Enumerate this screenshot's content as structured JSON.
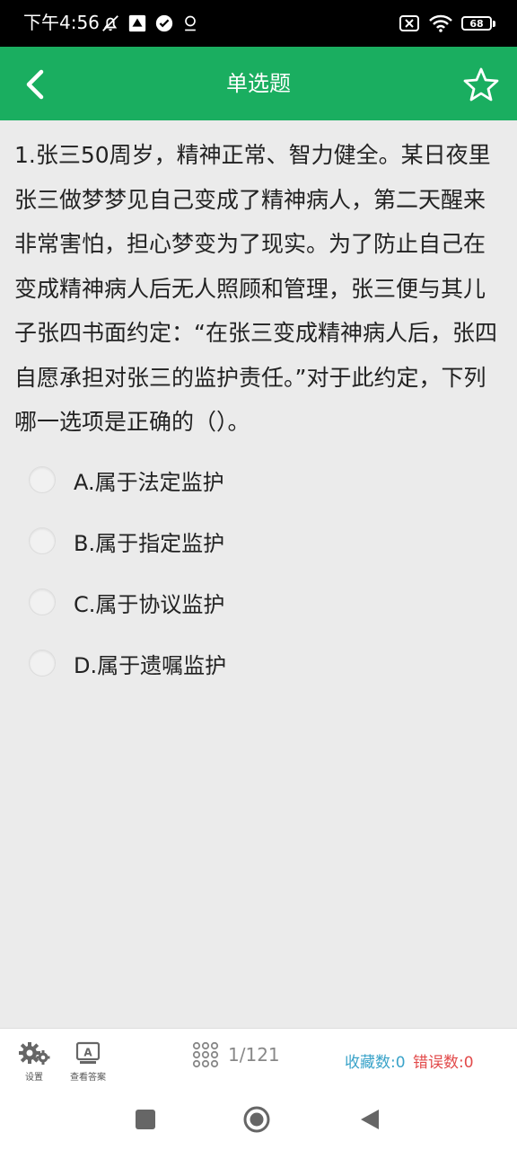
{
  "status": {
    "time": "下午4:56",
    "battery": "68"
  },
  "appbar": {
    "title": "单选题"
  },
  "question": {
    "text": "1.张三50周岁，精神正常、智力健全。某日夜里张三做梦梦见自己变成了精神病人，第二天醒来非常害怕，担心梦变为了现实。为了防止自己在变成精神病人后无人照顾和管理，张三便与其儿子张四书面约定：“在张三变成精神病人后，张四自愿承担对张三的监护责任。”对于此约定，下列哪一选项是正确的（）。"
  },
  "options": [
    {
      "label": "A.属于法定监护"
    },
    {
      "label": "B.属于指定监护"
    },
    {
      "label": "C.属于协议监护"
    },
    {
      "label": "D.属于遗嘱监护"
    }
  ],
  "bottom": {
    "settings_label": "设置",
    "answer_label": "查看答案",
    "progress": "1/121",
    "favorites": "收藏数:0",
    "errors": "错误数:0"
  },
  "colors": {
    "primary": "#1aae60",
    "favorites": "#3aa3c9",
    "errors": "#e24a4a"
  }
}
